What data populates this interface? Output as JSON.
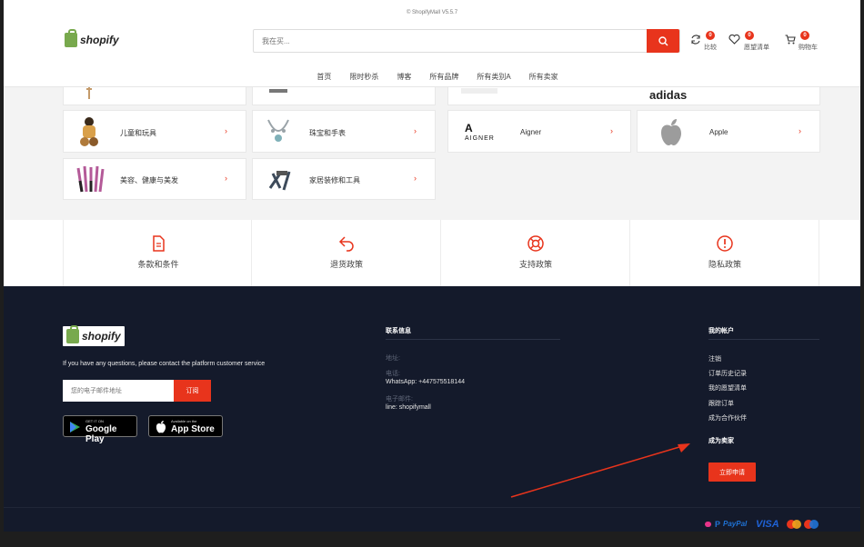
{
  "header": {
    "version": "© ShopifyMall V5.5.7",
    "logo_text": "shopify",
    "search_placeholder": "我在买...",
    "compare_label": "比较",
    "compare_count": "0",
    "wishlist_label": "愿望清单",
    "wishlist_count": "0",
    "cart_label": "购物车",
    "cart_count": "0"
  },
  "nav": [
    "首页",
    "限时秒杀",
    "博客",
    "所有品牌",
    "所有类别A",
    "所有卖家"
  ],
  "categories": [
    {
      "name": "儿童和玩具"
    },
    {
      "name": "珠宝和手表"
    },
    {
      "name": "美容、健康与美发"
    },
    {
      "name": "家居装修和工具"
    }
  ],
  "brands": [
    {
      "logo": "adidas"
    },
    {
      "name": "Aigner",
      "logo": "AIGNER"
    },
    {
      "name": "Apple"
    }
  ],
  "policies": [
    "条款和条件",
    "退货政策",
    "支持政策",
    "隐私政策"
  ],
  "footer": {
    "logo_text": "shopify",
    "help_text": "If you have any questions, please contact the platform customer service",
    "email_placeholder": "您的电子邮件地址",
    "subscribe_label": "订阅",
    "google_play_small": "GET IT ON",
    "google_play_big": "Google Play",
    "app_store_small": "Available on the",
    "app_store_big": "App Store",
    "contact_title": "联系信息",
    "address_label": "地址:",
    "phone_label": "电话:",
    "phone_value": "WhatsApp: +447575518144",
    "email_label": "电子邮件:",
    "email_value": "line: shopifymall",
    "account_title": "我的帐户",
    "account_links": [
      "注销",
      "订单历史记录",
      "我的愿望清单",
      "跟踪订单",
      "成为合作伙伴"
    ],
    "seller_title": "成为卖家",
    "apply_label": "立即申请",
    "payments": [
      "PayPal",
      "VISA"
    ]
  },
  "colors": {
    "accent": "#e8341c",
    "footer_bg": "#141a2b"
  }
}
